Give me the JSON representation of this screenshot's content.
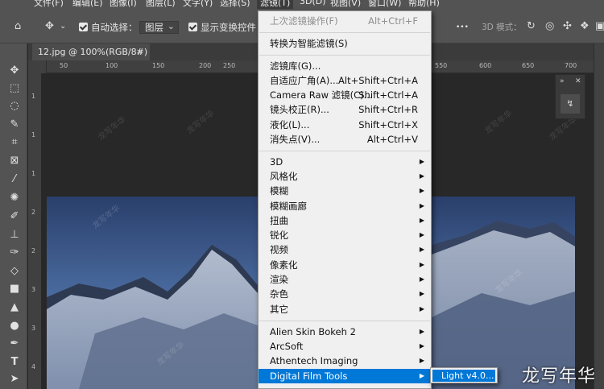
{
  "menubar": {
    "items": [
      {
        "label": "文件(F)"
      },
      {
        "label": "编辑(E)"
      },
      {
        "label": "图像(I)"
      },
      {
        "label": "图层(L)"
      },
      {
        "label": "文字(Y)"
      },
      {
        "label": "选择(S)"
      },
      {
        "label": "滤镜(T)"
      },
      {
        "label": "3D(D)"
      },
      {
        "label": "视图(V)"
      },
      {
        "label": "窗口(W)"
      },
      {
        "label": "帮助(H)"
      }
    ]
  },
  "options": {
    "auto_select_label": "自动选择：",
    "layer_select_value": "图层",
    "show_transform_label": "显示变换控件",
    "more_label": "•••",
    "mode_label": "3D 模式："
  },
  "document": {
    "tab_title": "12.jpg @ 100%(RGB/8#)",
    "close_label": "×"
  },
  "ruler": {
    "h_ticks": [
      "50",
      "100",
      "150",
      "200",
      "250",
      "550",
      "600",
      "650",
      "700"
    ],
    "v_ticks": [
      "1",
      "1",
      "1",
      "2",
      "2",
      "3",
      "3",
      "4"
    ]
  },
  "filter_menu": {
    "last_filter": {
      "label": "上次滤镜操作(F)",
      "shortcut": "Alt+Ctrl+F"
    },
    "smart": {
      "label": "转换为智能滤镜(S)"
    },
    "group1": [
      {
        "label": "滤镜库(G)...",
        "shortcut": ""
      },
      {
        "label": "自适应广角(A)...",
        "shortcut": "Alt+Shift+Ctrl+A"
      },
      {
        "label": "Camera Raw 滤镜(C)...",
        "shortcut": "Shift+Ctrl+A"
      },
      {
        "label": "镜头校正(R)...",
        "shortcut": "Shift+Ctrl+R"
      },
      {
        "label": "液化(L)...",
        "shortcut": "Shift+Ctrl+X"
      },
      {
        "label": "消失点(V)...",
        "shortcut": "Alt+Ctrl+V"
      }
    ],
    "group2": [
      {
        "label": "3D"
      },
      {
        "label": "风格化"
      },
      {
        "label": "模糊"
      },
      {
        "label": "模糊画廊"
      },
      {
        "label": "扭曲"
      },
      {
        "label": "锐化"
      },
      {
        "label": "视频"
      },
      {
        "label": "像素化"
      },
      {
        "label": "渲染"
      },
      {
        "label": "杂色"
      },
      {
        "label": "其它"
      }
    ],
    "group3": [
      {
        "label": "Alien Skin Bokeh 2"
      },
      {
        "label": "ArcSoft"
      },
      {
        "label": "Athentech Imaging"
      },
      {
        "label": "Digital Film Tools"
      }
    ]
  },
  "submenu": {
    "item": "Light v4.0..."
  },
  "watermark": "龙写年华",
  "canvas_watermark": "龙写年华",
  "colors": {
    "highlight": "#0078d7",
    "menu_bg": "#f0f0f0",
    "ui_bg": "#535353"
  }
}
